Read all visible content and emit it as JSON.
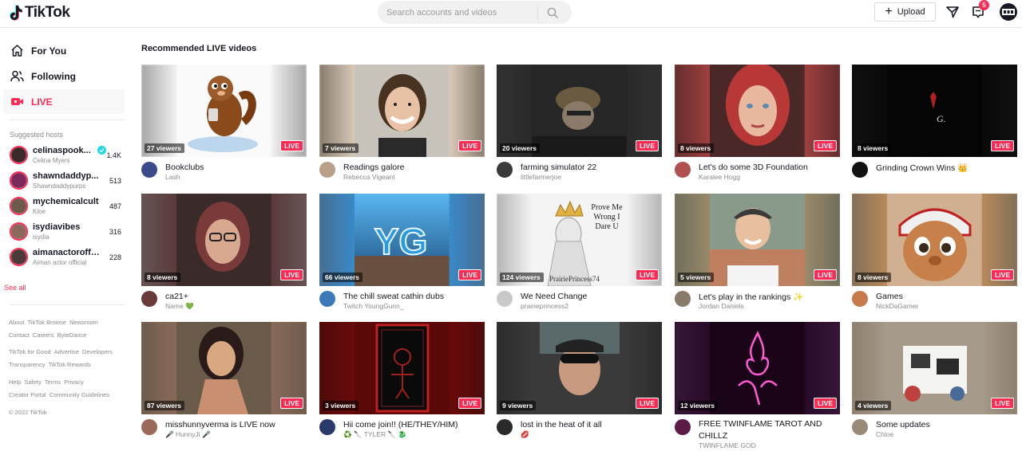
{
  "header": {
    "logo_text": "TikTok",
    "search_placeholder": "Search accounts and videos",
    "upload_label": "Upload",
    "inbox_badge": "5"
  },
  "sidebar": {
    "nav": [
      {
        "label": "For You",
        "icon": "home-icon"
      },
      {
        "label": "Following",
        "icon": "users-icon"
      },
      {
        "label": "LIVE",
        "icon": "live-icon"
      }
    ],
    "suggested_heading": "Suggested hosts",
    "hosts": [
      {
        "name": "celinaspook...",
        "sub": "Celina Myers",
        "count": "1.4K",
        "verified": true,
        "color": "#3a2a2a"
      },
      {
        "name": "shawndaddyp...",
        "sub": "Shawndaddypurps",
        "count": "513",
        "verified": false,
        "color": "#7a2a5a"
      },
      {
        "name": "mychemicalcult",
        "sub": "Kloe",
        "count": "487",
        "verified": false,
        "color": "#6a5a4a"
      },
      {
        "name": "isydiavibes",
        "sub": "isydia",
        "count": "316",
        "verified": false,
        "color": "#8a6a5a"
      },
      {
        "name": "aimanactoroffi...",
        "sub": "Aiman actor official",
        "count": "228",
        "verified": false,
        "color": "#4a3a3a"
      }
    ],
    "see_all": "See all",
    "footer_rows": [
      [
        "About",
        "TikTok Browse",
        "Newsroom"
      ],
      [
        "Contact",
        "Careers",
        "ByteDance"
      ],
      [
        "TikTok for Good",
        "Advertise",
        "Developers"
      ],
      [
        "Transparency",
        "TikTok Rewards"
      ],
      [
        "Help",
        "Safety",
        "Terms",
        "Privacy"
      ],
      [
        "Creator Portal",
        "Community Guidelines"
      ]
    ],
    "copyright": "© 2022 TikTok"
  },
  "main": {
    "title": "Recommended LIVE videos",
    "live_label": "LIVE",
    "cards": [
      {
        "viewers": "27 viewers",
        "title": "Bookclubs",
        "sub": "Lash",
        "bg": "#f2f2f2",
        "side": "#9a9a9a",
        "av": "#3a4a8a"
      },
      {
        "viewers": "7 viewers",
        "title": "Readings galore",
        "sub": "Rebecca Vigeant",
        "bg": "#d9c9b9",
        "side": "#7a7060",
        "av": "#b9a08a"
      },
      {
        "viewers": "20 viewers",
        "title": "farming simulator 22",
        "sub": "littlefarmerjoe",
        "bg": "#2a2a2a",
        "side": "#333333",
        "av": "#3a3a3a"
      },
      {
        "viewers": "8 viewers",
        "title": "Let's do some 3D Foundation",
        "sub": "Karalee Hogg",
        "bg": "#a04040",
        "side": "#5a2a2a",
        "av": "#b05050"
      },
      {
        "viewers": "8 viewers",
        "title": "Grinding Crown Wins 👑",
        "sub": "",
        "bg": "#0a0a0a",
        "side": "#111111",
        "av": "#111111"
      },
      {
        "viewers": "8 viewers",
        "title": "ca21+",
        "sub": "Name 💚",
        "bg": "#5a3a3a",
        "side": "#6a5a5a",
        "av": "#6a3a3a"
      },
      {
        "viewers": "66 viewers",
        "title": "The chill sweat cathin dubs",
        "sub": "Twitch YoungGunn_",
        "bg": "#3a8ac9",
        "side": "#4a6a8a",
        "av": "#3a7ab9"
      },
      {
        "viewers": "124 viewers",
        "title": "We Need Change",
        "sub": "prairieprincess2",
        "bg": "#f4f4f4",
        "side": "#aaaaaa",
        "av": "#c9c9c9"
      },
      {
        "viewers": "5 viewers",
        "title": "Let's play in the rankings ✨",
        "sub": "Jordan Daniels",
        "bg": "#9a8a6a",
        "side": "#6a6a5a",
        "av": "#8a7a6a"
      },
      {
        "viewers": "8 viewers",
        "title": "Games",
        "sub": "NickDaGamer",
        "bg": "#b98a5a",
        "side": "#7a6a5a",
        "av": "#c97a4a"
      },
      {
        "viewers": "87 viewers",
        "title": "misshunnyverma is LIVE now",
        "sub": "🎤 HunnyJi 🎤",
        "bg": "#8a6a5a",
        "side": "#6a5a4a",
        "av": "#9a6a5a"
      },
      {
        "viewers": "3 viewers",
        "title": "Hii come join!! (HE/THEY/HIM)",
        "sub": "♻️ 🔪 TYLER 🔪 🐉",
        "bg": "#6a0a0a",
        "side": "#4a0a0a",
        "av": "#2a3a6a"
      },
      {
        "viewers": "9 viewers",
        "title": "lost in the heat of it all",
        "sub": "💋",
        "bg": "#3a3a3a",
        "side": "#2a2a2a",
        "av": "#2a2a2a"
      },
      {
        "viewers": "12 viewers",
        "title": "FREE TWINFLAME TAROT AND CHILLZ",
        "sub": "TWINFLAME GOD",
        "bg": "#2a0a2a",
        "side": "#3a1a3a",
        "av": "#5a1a4a"
      },
      {
        "viewers": "4 viewers",
        "title": "Some updates",
        "sub": "Chloe",
        "bg": "#a69a8a",
        "side": "#8a7a6a",
        "av": "#9a8a7a"
      }
    ]
  },
  "thumb_texts": {
    "prove": "Prove Me Wrong I Dare U",
    "prairie": "PrairiePrincess74",
    "yg": "YG"
  }
}
